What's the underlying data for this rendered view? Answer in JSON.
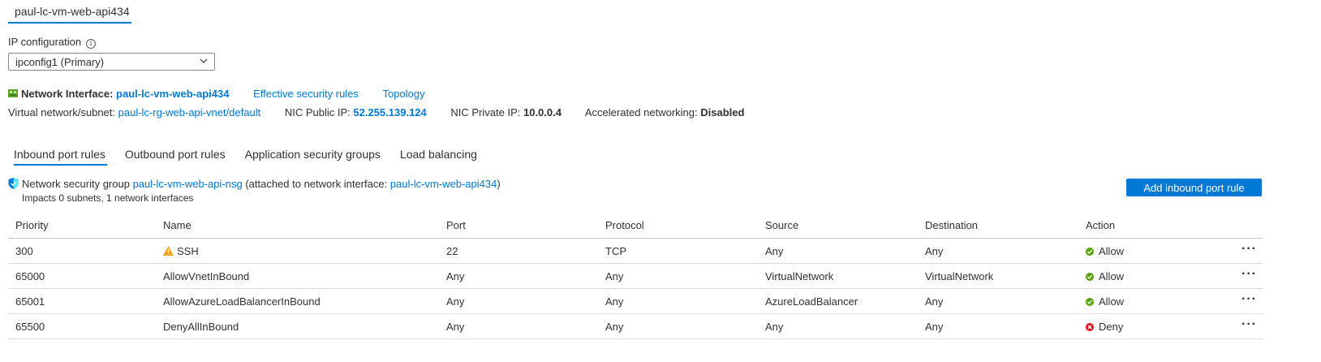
{
  "top_tab": {
    "label": "paul-lc-vm-web-api434"
  },
  "ip_config": {
    "label": "IP configuration",
    "info_icon": "info-icon",
    "selected": "ipconfig1 (Primary)"
  },
  "nic": {
    "label": "Network Interface:",
    "name": "paul-lc-vm-web-api434",
    "effective_rules": "Effective security rules",
    "topology": "Topology",
    "vnet_label": "Virtual network/subnet:",
    "vnet_value": "paul-lc-rg-web-api-vnet/default",
    "public_ip_label": "NIC Public IP:",
    "public_ip_value": "52.255.139.124",
    "private_ip_label": "NIC Private IP:",
    "private_ip_value": "10.0.0.4",
    "accel_label": "Accelerated networking:",
    "accel_value": "Disabled"
  },
  "tabs": [
    {
      "label": "Inbound port rules",
      "active": true
    },
    {
      "label": "Outbound port rules"
    },
    {
      "label": "Application security groups"
    },
    {
      "label": "Load balancing"
    }
  ],
  "nsg": {
    "prefix": "Network security group",
    "name": "paul-lc-vm-web-api-nsg",
    "attached_text": "(attached to network interface:",
    "attached_nic": "paul-lc-vm-web-api434",
    "close_paren": ")",
    "impacts": "Impacts 0 subnets, 1 network interfaces"
  },
  "add_button": "Add inbound port rule",
  "table": {
    "headers": [
      "Priority",
      "Name",
      "Port",
      "Protocol",
      "Source",
      "Destination",
      "Action"
    ],
    "rows": [
      {
        "priority": "300",
        "name": "SSH",
        "warning": true,
        "port": "22",
        "protocol": "TCP",
        "source": "Any",
        "destination": "Any",
        "action": "Allow",
        "status": "allow"
      },
      {
        "priority": "65000",
        "name": "AllowVnetInBound",
        "port": "Any",
        "protocol": "Any",
        "source": "VirtualNetwork",
        "destination": "VirtualNetwork",
        "action": "Allow",
        "status": "allow"
      },
      {
        "priority": "65001",
        "name": "AllowAzureLoadBalancerInBound",
        "port": "Any",
        "protocol": "Any",
        "source": "AzureLoadBalancer",
        "destination": "Any",
        "action": "Allow",
        "status": "allow"
      },
      {
        "priority": "65500",
        "name": "DenyAllInBound",
        "port": "Any",
        "protocol": "Any",
        "source": "Any",
        "destination": "Any",
        "action": "Deny",
        "status": "deny"
      }
    ],
    "more_glyph": "···"
  },
  "colors": {
    "accent": "#0078d4",
    "allow": "#57a300",
    "deny": "#e00b1c",
    "warning": "#f7a01c"
  }
}
